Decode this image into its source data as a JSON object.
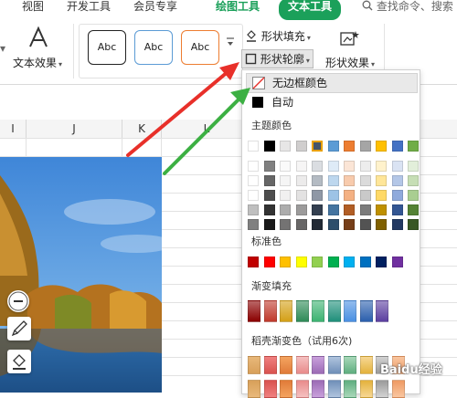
{
  "tabs": {
    "view": "视图",
    "dev": "开发工具",
    "member": "会员专享",
    "draw_tools": "绘图工具",
    "text_tools": "文本工具",
    "search_placeholder": "查找命令、搜索"
  },
  "ribbon": {
    "text_effect": "文本效果",
    "style_sample": "Abc",
    "shape_fill": "形状填充",
    "shape_outline": "形状轮廓",
    "shape_effect": "形状效果"
  },
  "columns": [
    "I",
    "J",
    "K",
    "L"
  ],
  "menu": {
    "no_border": "无边框颜色",
    "auto": "自动",
    "theme_colors": "主题颜色",
    "standard_colors": "标准色",
    "gradient_fill": "渐变填充",
    "dao_gradient": "稻壳渐变色（试用6次)"
  },
  "watermark": "Baidu经验",
  "colors": {
    "accent_green": "#1ba05a",
    "arrow_red": "#e8302a",
    "arrow_green": "#3cb043",
    "theme_row": [
      "#ffffff",
      "#000000",
      "#e7e6e6",
      "#d0cece",
      "#44546a",
      "#5b9bd5",
      "#ed7d31",
      "#a5a5a5",
      "#ffc000",
      "#4472c4",
      "#70ad47"
    ],
    "standard_row": [
      "#c00000",
      "#ff0000",
      "#ffc000",
      "#ffff00",
      "#92d050",
      "#00b050",
      "#00b0f0",
      "#0070c0",
      "#002060",
      "#7030a0"
    ]
  }
}
